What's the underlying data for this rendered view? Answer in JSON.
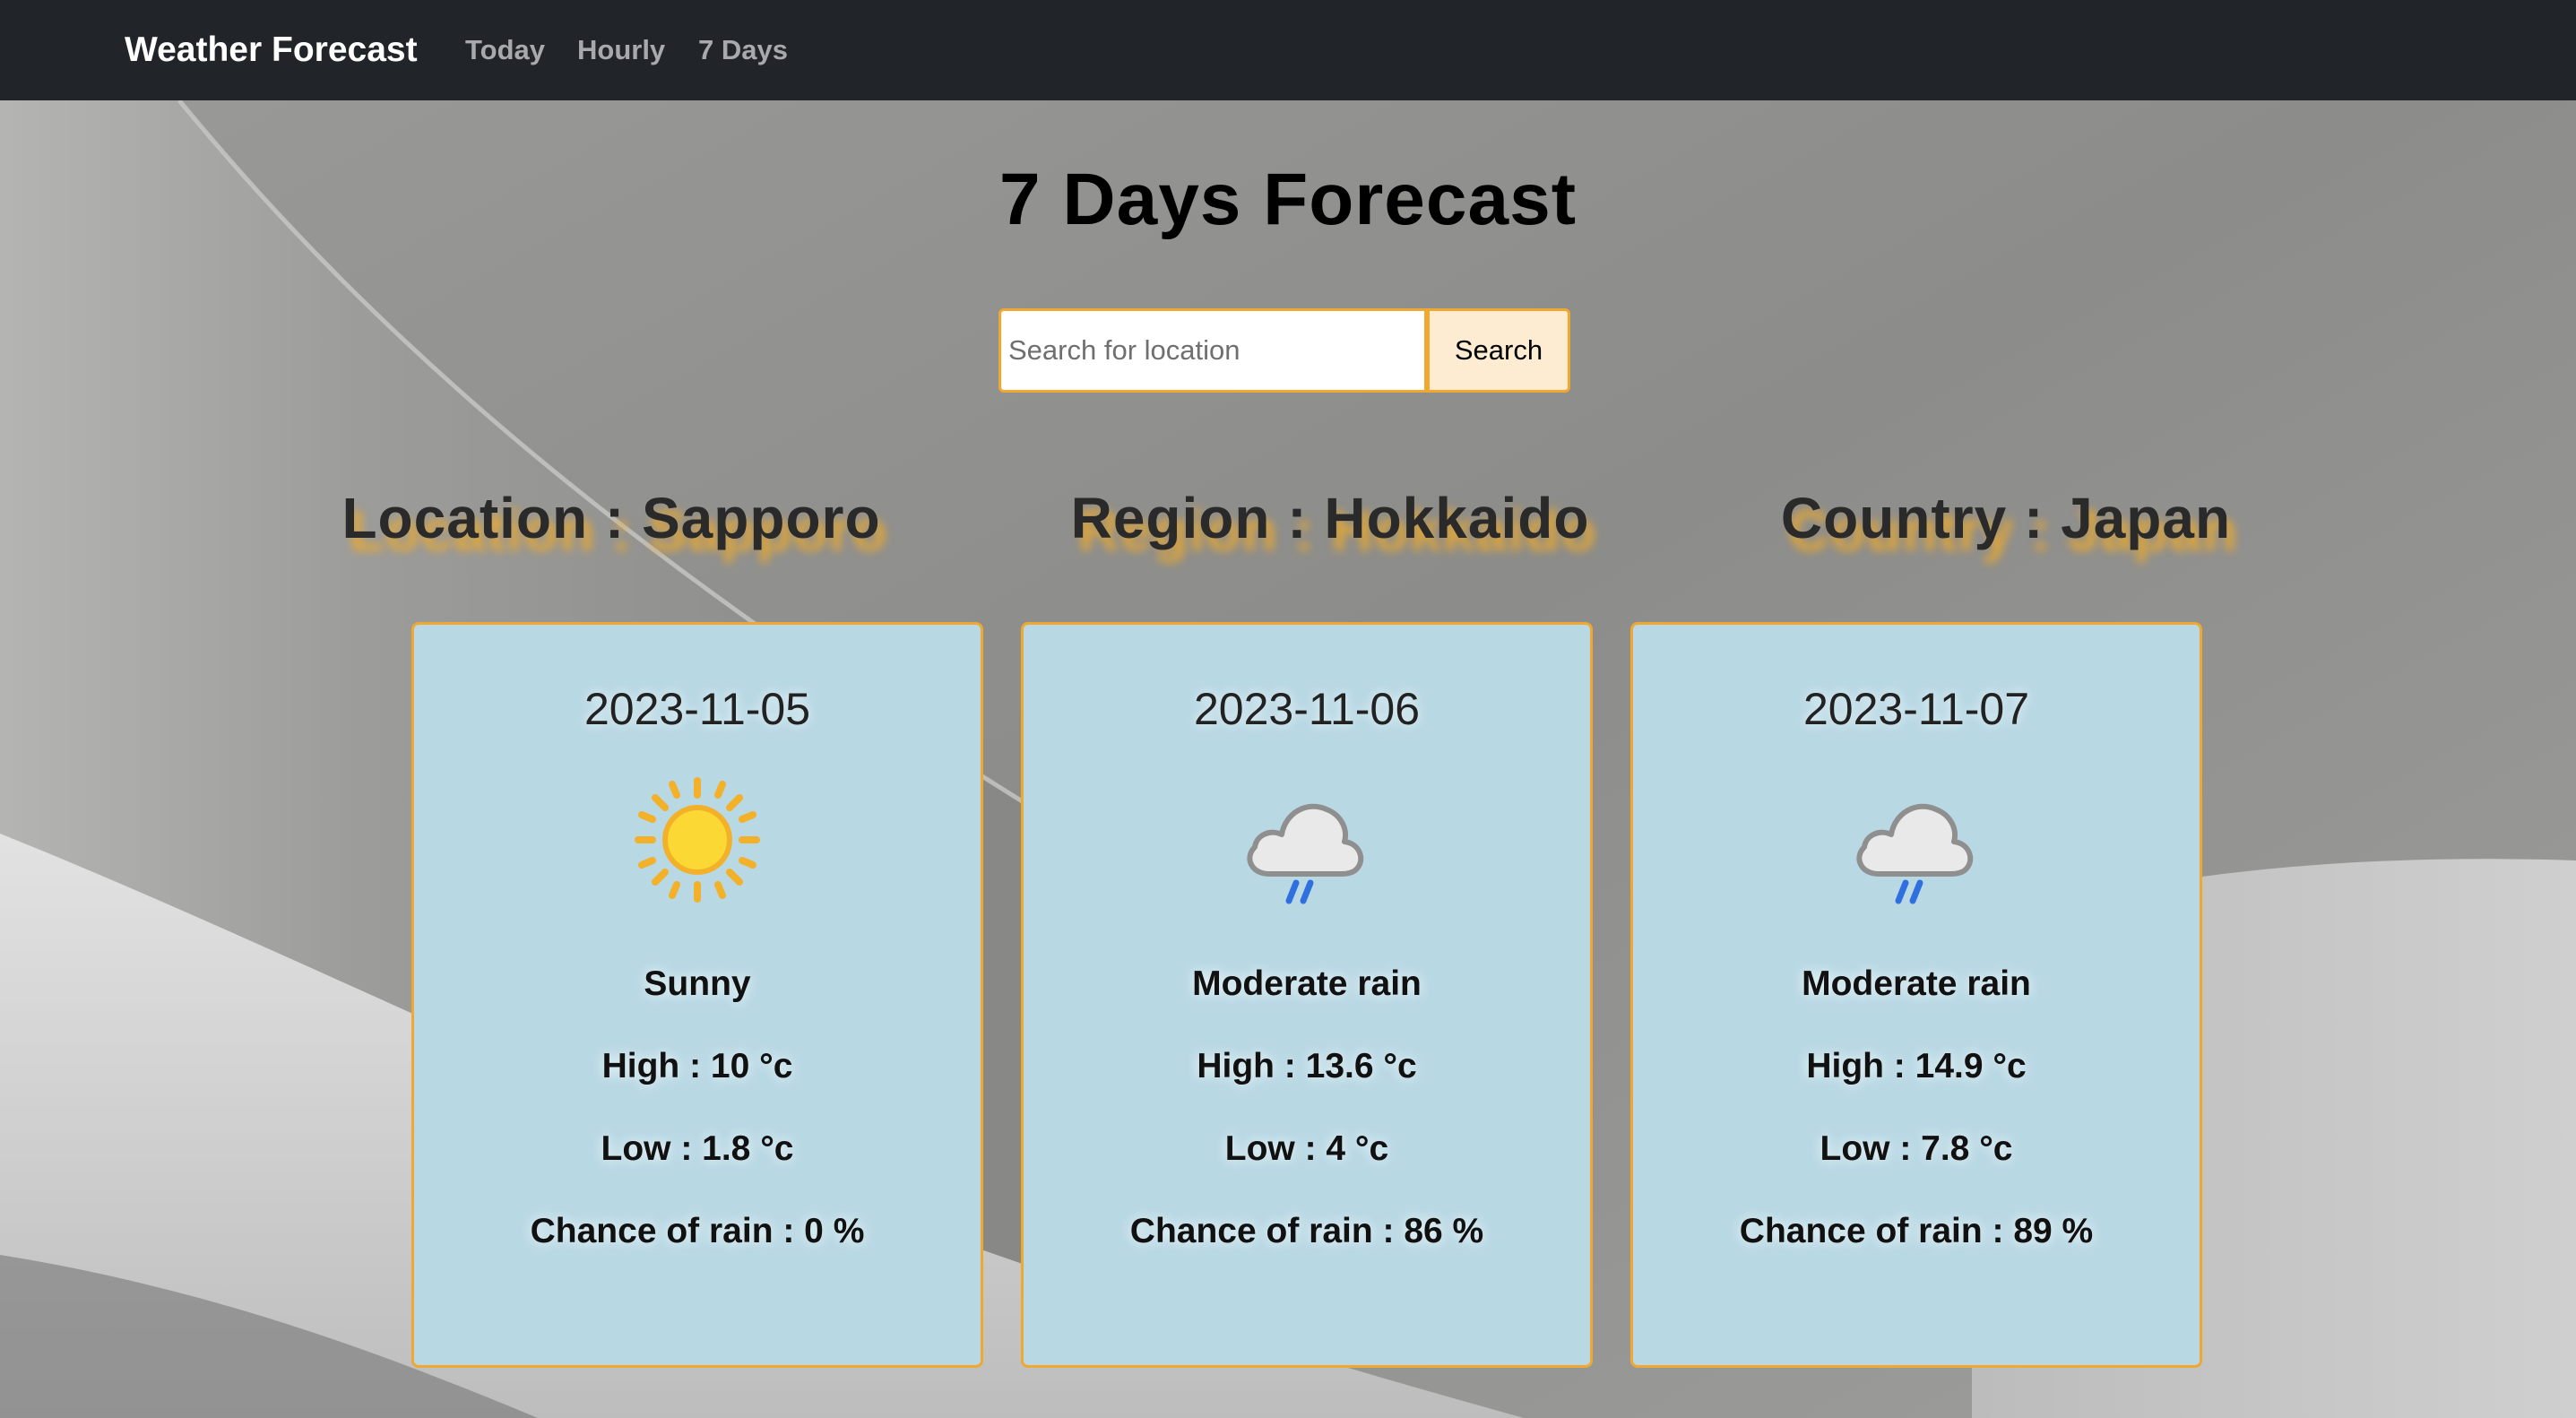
{
  "navbar": {
    "brand": "Weather Forecast",
    "links": [
      "Today",
      "Hourly",
      "7 Days"
    ]
  },
  "page": {
    "title": "7 Days Forecast"
  },
  "search": {
    "placeholder": "Search for location",
    "value": "",
    "button_label": "Search"
  },
  "location": {
    "location_text": "Location : Sapporo",
    "region_text": "Region : Hokkaido",
    "country_text": "Country : Japan"
  },
  "forecast": [
    {
      "date": "2023-11-05",
      "icon": "sun-icon",
      "condition": "Sunny",
      "high": "High : 10 °c",
      "low": "Low : 1.8 °c",
      "rain": "Chance of rain : 0 %"
    },
    {
      "date": "2023-11-06",
      "icon": "rain-cloud-icon",
      "condition": "Moderate rain",
      "high": "High : 13.6 °c",
      "low": "Low : 4 °c",
      "rain": "Chance of rain : 86 %"
    },
    {
      "date": "2023-11-07",
      "icon": "rain-cloud-icon",
      "condition": "Moderate rain",
      "high": "High : 14.9 °c",
      "low": "Low : 7.8 °c",
      "rain": "Chance of rain : 89 %"
    }
  ],
  "colors": {
    "navbar_bg": "#212529",
    "accent": "#f0a830",
    "card_bg": "#b8d8e4",
    "search_button_bg": "#fdecd2"
  }
}
